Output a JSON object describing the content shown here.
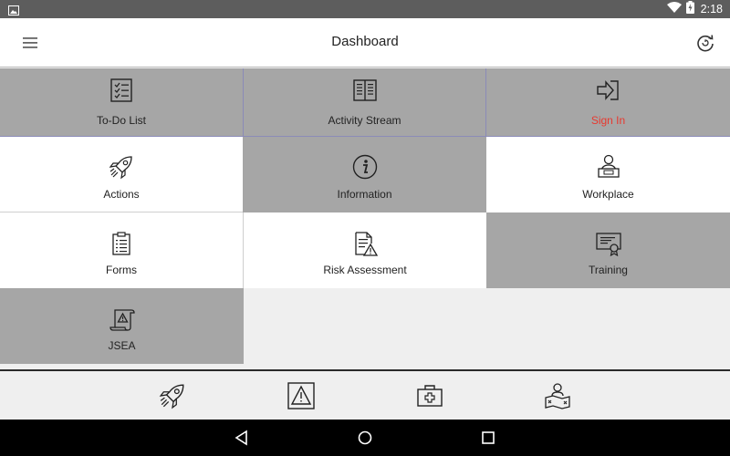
{
  "status_bar": {
    "time": "2:18",
    "icons": [
      "image-notification-icon",
      "wifi-icon",
      "battery-charging-icon"
    ]
  },
  "app_bar": {
    "title": "Dashboard",
    "menu_icon": "hamburger-menu-icon",
    "refresh_icon": "refresh-icon"
  },
  "tiles": [
    {
      "label": "To-Do List",
      "icon": "checklist-icon"
    },
    {
      "label": "Activity Stream",
      "icon": "book-icon"
    },
    {
      "label": "Sign In",
      "icon": "sign-in-icon",
      "label_color": "#e8392f"
    },
    {
      "label": "Actions",
      "icon": "rocket-icon"
    },
    {
      "label": "Information",
      "icon": "info-icon"
    },
    {
      "label": "Workplace",
      "icon": "workplace-icon"
    },
    {
      "label": "Forms",
      "icon": "clipboard-icon"
    },
    {
      "label": "Risk Assessment",
      "icon": "risk-document-icon"
    },
    {
      "label": "Training",
      "icon": "certificate-icon"
    },
    {
      "label": "JSEA",
      "icon": "warning-scroll-icon"
    }
  ],
  "bottom_bar": {
    "icons": [
      "rocket-icon",
      "warning-icon",
      "first-aid-kit-icon",
      "person-map-icon"
    ]
  },
  "nav_bar": {
    "icons": [
      "back-icon",
      "home-icon",
      "recents-icon"
    ]
  },
  "colors": {
    "tile_gray": "#a6a6a6",
    "tile_white": "#ffffff",
    "accent_red": "#e8392f",
    "status_bar": "#5d5d5d"
  }
}
